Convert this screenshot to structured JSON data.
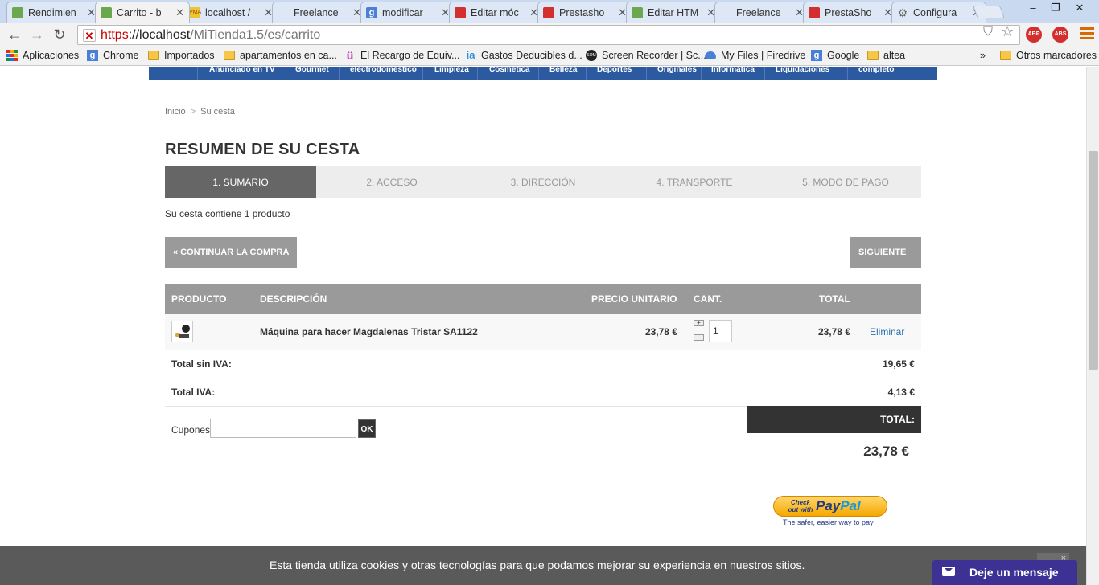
{
  "browser": {
    "tabs": [
      {
        "title": "Rendimien",
        "favicon": "green-doc-icon"
      },
      {
        "title": "Carrito - b",
        "favicon": "green-doc-icon",
        "active": true
      },
      {
        "title": "localhost /",
        "favicon": "pma-icon"
      },
      {
        "title": "Freelance",
        "favicon": "blank-icon"
      },
      {
        "title": "modificar",
        "favicon": "google-icon"
      },
      {
        "title": "Editar móc",
        "favicon": "youtube-icon"
      },
      {
        "title": "Prestasho",
        "favicon": "youtube-icon"
      },
      {
        "title": "Editar HTM",
        "favicon": "green-doc-icon"
      },
      {
        "title": "Freelance",
        "favicon": "blank-icon"
      },
      {
        "title": "PrestaSho",
        "favicon": "youtube-icon"
      },
      {
        "title": "Configura",
        "favicon": "gear-icon"
      }
    ],
    "url": {
      "scheme": "https",
      "host": "://localhost",
      "path": "/MiTienda1.5/es/carrito"
    },
    "extensions": {
      "abp": "ABP",
      "abs": "ABS"
    },
    "bookmarks": [
      {
        "label": "Aplicaciones",
        "icon": "apps-icon"
      },
      {
        "label": "Chrome",
        "icon": "google-icon"
      },
      {
        "label": "Importados",
        "icon": "folder-icon"
      },
      {
        "label": "apartamentos en ca...",
        "icon": "folder-icon"
      },
      {
        "label": "El Recargo de Equiv...",
        "icon": "u-icon"
      },
      {
        "label": "Gastos Deducibles d...",
        "icon": "ia-icon"
      },
      {
        "label": "Screen Recorder | Sc...",
        "icon": "som-icon"
      },
      {
        "label": "My Files | Firedrive",
        "icon": "cloud-icon"
      },
      {
        "label": "Google",
        "icon": "google-icon"
      },
      {
        "label": "altea",
        "icon": "folder-icon"
      }
    ],
    "bookmarks_overflow": "»",
    "other_bookmarks": "Otros marcadores"
  },
  "shop": {
    "categories": [
      "Anunciado en TV",
      "Gourmet",
      "electrodoméstico",
      "Limpieza",
      "Cosmética",
      "Belleza",
      "Deportes",
      "Originales",
      "Informática",
      "Liquidaciones",
      "completo"
    ],
    "breadcrumb": {
      "home": "Inicio",
      "sep": ">",
      "current": "Su cesta"
    },
    "title": "RESUMEN DE SU CESTA",
    "steps": [
      "1. SUMARIO",
      "2. ACCESO",
      "3. DIRECCIÓN",
      "4. TRANSPORTE",
      "5. MODO DE PAGO"
    ],
    "cart_count_text": "Su cesta contiene 1 producto",
    "continue_button": "« CONTINUAR LA COMPRA",
    "next_button": "SIGUIENTE »",
    "columns": {
      "product": "PRODUCTO",
      "description": "DESCRIPCIÓN",
      "unit_price": "PRECIO UNITARIO",
      "qty": "CANT.",
      "total": "TOTAL"
    },
    "item": {
      "name": "Máquina para hacer Magdalenas Tristar SA1122",
      "unit_price": "23,78 €",
      "qty": "1",
      "total": "23,78 €",
      "remove": "Eliminar"
    },
    "summary": [
      {
        "label": "Total sin IVA:",
        "value": "19,65 €"
      },
      {
        "label": "Total IVA:",
        "value": "4,13 €"
      }
    ],
    "coupon": {
      "label": "Cupones",
      "placeholder": "",
      "button": "OK"
    },
    "total_label": "TOTAL:",
    "total_amount": "23,78 €",
    "paypal": {
      "small": "Check out with",
      "logo_a": "Pay",
      "logo_b": "Pal",
      "tagline": "The safer, easier way to pay"
    },
    "cookie_text": "Esta tienda utiliza cookies y otras tecnologías para que podamos mejorar su experiencia en nuestros sitios.",
    "cookie_close": "×",
    "chat_label": "Deje un mensaje"
  }
}
